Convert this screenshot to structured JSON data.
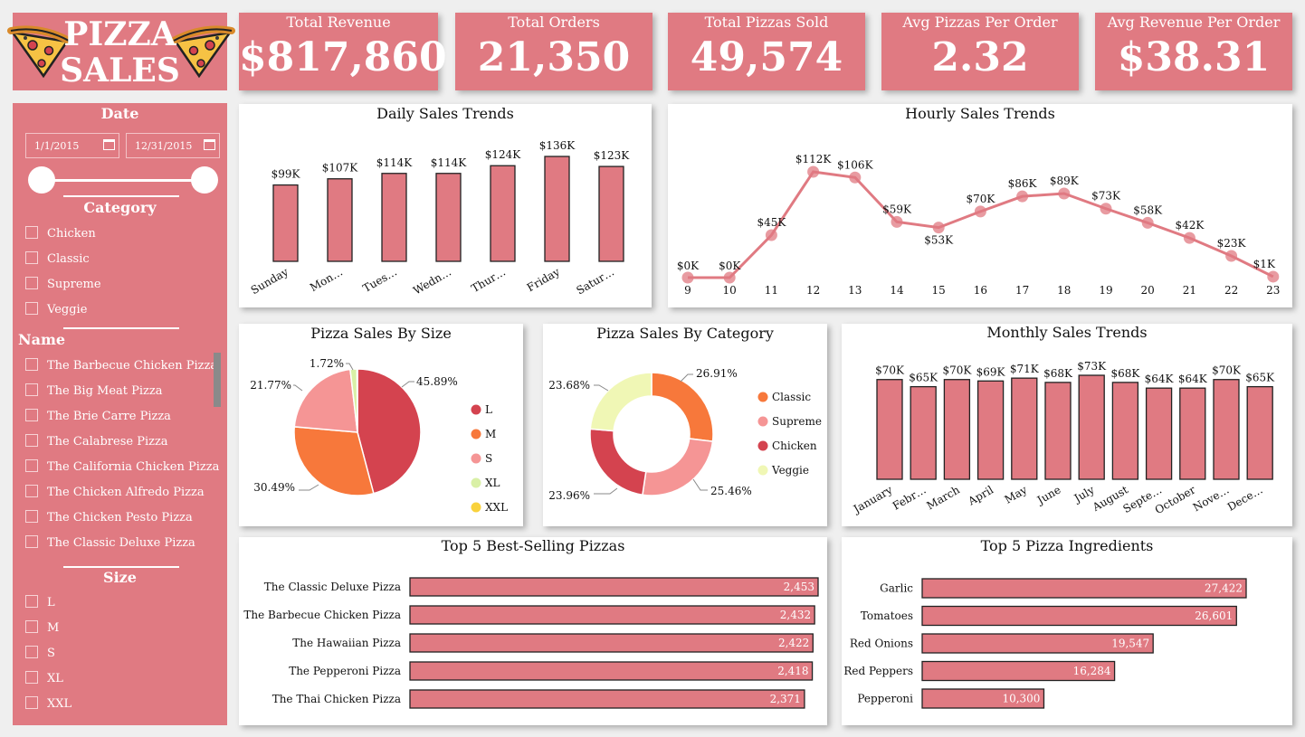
{
  "header": {
    "logo_line1": "PIZZA",
    "logo_line2": "SALES",
    "logo_icon": "pizza-slice-icon"
  },
  "kpis": [
    {
      "label": "Total Revenue",
      "value": "$817,860"
    },
    {
      "label": "Total Orders",
      "value": "21,350"
    },
    {
      "label": "Total Pizzas Sold",
      "value": "49,574"
    },
    {
      "label": "Avg Pizzas Per Order",
      "value": "2.32"
    },
    {
      "label": "Avg Revenue Per Order",
      "value": "$38.31"
    }
  ],
  "filters": {
    "date": {
      "title": "Date",
      "start": "1/1/2015",
      "end": "12/31/2015",
      "icon": "calendar-icon"
    },
    "category": {
      "title": "Category",
      "options": [
        "Chicken",
        "Classic",
        "Supreme",
        "Veggie"
      ]
    },
    "name": {
      "title": "Name",
      "options": [
        "The Barbecue Chicken Pizza",
        "The Big Meat Pizza",
        "The Brie Carre Pizza",
        "The Calabrese Pizza",
        "The California Chicken Pizza",
        "The Chicken Alfredo Pizza",
        "The Chicken Pesto Pizza",
        "The Classic Deluxe Pizza"
      ]
    },
    "size": {
      "title": "Size",
      "options": [
        "L",
        "M",
        "S",
        "XL",
        "XXL"
      ]
    }
  },
  "colors": {
    "accent": "#e07a82",
    "pie_L": "#d4434f",
    "pie_M": "#f7783b",
    "pie_S": "#f59595",
    "pie_XL": "#d9f0a6",
    "pie_XXL": "#f9d23c",
    "cat_Classic": "#f7783b",
    "cat_Supreme": "#f59595",
    "cat_Chicken": "#d4434f",
    "cat_Veggie": "#f0f7b5"
  },
  "chart_data": [
    {
      "id": "daily",
      "type": "bar",
      "title": "Daily Sales Trends",
      "categories": [
        "Sunday",
        "Mon…",
        "Tues…",
        "Wedn…",
        "Thur…",
        "Friday",
        "Satur…"
      ],
      "values": [
        99,
        107,
        114,
        114,
        124,
        136,
        123
      ],
      "labels": [
        "$99K",
        "$107K",
        "$114K",
        "$114K",
        "$124K",
        "$136K",
        "$123K"
      ],
      "unit": "K$",
      "ylim": [
        0,
        136
      ]
    },
    {
      "id": "hourly",
      "type": "line",
      "title": "Hourly Sales Trends",
      "x": [
        "9",
        "10",
        "11",
        "12",
        "13",
        "14",
        "15",
        "16",
        "17",
        "18",
        "19",
        "20",
        "21",
        "22",
        "23"
      ],
      "values": [
        0,
        0,
        45,
        112,
        106,
        59,
        53,
        70,
        86,
        89,
        73,
        58,
        42,
        23,
        1
      ],
      "labels": [
        "$0K",
        "$0K",
        "$45K",
        "$112K",
        "$106K",
        "$59K",
        "$53K",
        "$70K",
        "$86K",
        "$89K",
        "$73K",
        "$58K",
        "$42K",
        "$23K",
        "$1K"
      ],
      "ylim": [
        0,
        112
      ]
    },
    {
      "id": "size",
      "type": "pie",
      "title": "Pizza Sales By Size",
      "categories": [
        "L",
        "M",
        "S",
        "XL",
        "XXL"
      ],
      "values": [
        45.89,
        30.49,
        21.77,
        1.72,
        0.12
      ],
      "labels": [
        "45.89%",
        "30.49%",
        "21.77%",
        "1.72%",
        ""
      ]
    },
    {
      "id": "category",
      "type": "pie",
      "title": "Pizza Sales By Category",
      "categories": [
        "Classic",
        "Supreme",
        "Chicken",
        "Veggie"
      ],
      "values": [
        26.91,
        25.46,
        23.96,
        23.68
      ],
      "labels": [
        "26.91%",
        "25.46%",
        "23.96%",
        "23.68%"
      ]
    },
    {
      "id": "monthly",
      "type": "bar",
      "title": "Monthly Sales Trends",
      "categories": [
        "January",
        "Febr…",
        "March",
        "April",
        "May",
        "June",
        "July",
        "August",
        "Septe…",
        "October",
        "Nove…",
        "Dece…"
      ],
      "values": [
        70,
        65,
        70,
        69,
        71,
        68,
        73,
        68,
        64,
        64,
        70,
        65
      ],
      "labels": [
        "$70K",
        "$65K",
        "$70K",
        "$69K",
        "$71K",
        "$68K",
        "$73K",
        "$68K",
        "$64K",
        "$64K",
        "$70K",
        "$65K"
      ],
      "ylim": [
        0,
        73
      ]
    },
    {
      "id": "top5pizzas",
      "type": "bar",
      "orientation": "horizontal",
      "title": "Top 5 Best-Selling Pizzas",
      "categories": [
        "The Classic Deluxe Pizza",
        "The Barbecue Chicken Pizza",
        "The Hawaiian Pizza",
        "The Pepperoni Pizza",
        "The Thai Chicken Pizza"
      ],
      "values": [
        2453,
        2432,
        2422,
        2418,
        2371
      ],
      "labels": [
        "2,453",
        "2,432",
        "2,422",
        "2,418",
        "2,371"
      ]
    },
    {
      "id": "top5ingredients",
      "type": "bar",
      "orientation": "horizontal",
      "title": "Top 5 Pizza Ingredients",
      "categories": [
        "Garlic",
        "Tomatoes",
        "Red Onions",
        "Red Peppers",
        "Pepperoni"
      ],
      "values": [
        27422,
        26601,
        19547,
        16284,
        10300
      ],
      "labels": [
        "27,422",
        "26,601",
        "19,547",
        "16,284",
        "10,300"
      ]
    }
  ]
}
